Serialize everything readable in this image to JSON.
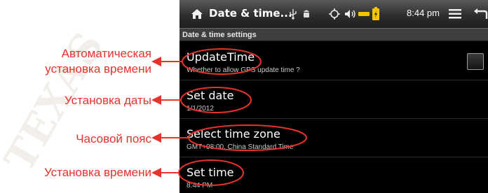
{
  "annotations": {
    "update_time_line1": "Автоматическая",
    "update_time_line2": "установка времени",
    "set_date": "Установка даты",
    "time_zone": "Часовой пояс",
    "set_time": "Установка времени"
  },
  "statusbar": {
    "title": "Date & time...",
    "time": "8:44 pm",
    "icons": [
      "home-icon",
      "usb-icon",
      "android-debug-icon",
      "gps-icon",
      "volume-icon",
      "battery-icon",
      "menu-icon",
      "back-icon"
    ]
  },
  "screen": {
    "subheader": "Date & time settings",
    "items": [
      {
        "title": "UpdateTime",
        "summary": "Whether to allow GPS update time ?",
        "checked": false
      },
      {
        "title": "Set date",
        "summary": "1/1/2012"
      },
      {
        "title": "Select time zone",
        "summary": "GMT+08:00, China Standard Time"
      },
      {
        "title": "Set time",
        "summary": "8:44 PM"
      }
    ]
  },
  "colors": {
    "annotation": "#e8322c",
    "background": "#000000",
    "battery": "#f5c400"
  }
}
